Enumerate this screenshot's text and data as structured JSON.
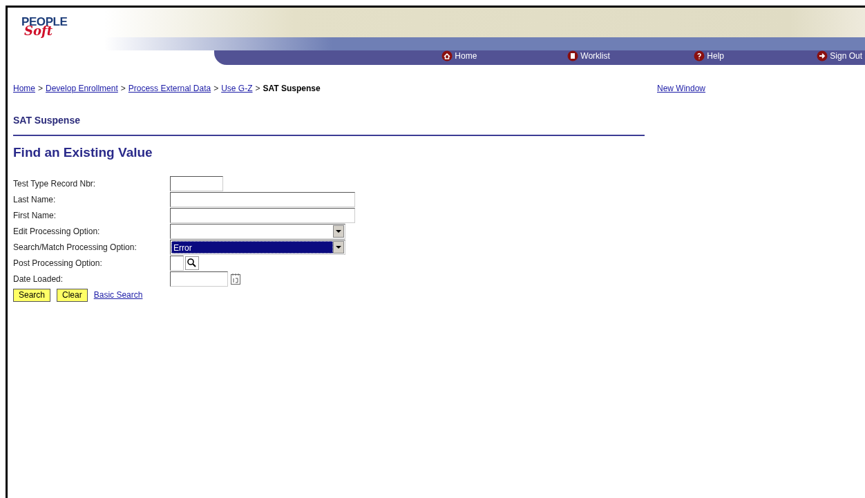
{
  "logo": {
    "line_1": "PEOPLE",
    "line_2": "Soft"
  },
  "nav": [
    {
      "label": "Home",
      "kind": "home"
    },
    {
      "label": "Worklist",
      "kind": "worklist"
    },
    {
      "label": "Help",
      "kind": "help"
    },
    {
      "label": "Sign Out",
      "kind": "signout"
    }
  ],
  "breadcrumb": {
    "links": [
      "Home",
      "Develop Enrollment",
      "Process External Data",
      "Use G-Z"
    ],
    "separator": ">",
    "current": "SAT Suspense"
  },
  "new_window": "New Window",
  "page_title": "SAT Suspense",
  "heading": "Find an Existing Value",
  "fields": [
    {
      "label": "Test Type Record Nbr:",
      "kind": "short_text"
    },
    {
      "label": "Last Name:",
      "kind": "text"
    },
    {
      "label": "First Name:",
      "kind": "text"
    },
    {
      "label": "Edit Processing Option:",
      "kind": "select",
      "selected": false
    },
    {
      "label": "Search/Match Processing Option:",
      "kind": "select",
      "value": "Error",
      "selected": true
    },
    {
      "label": "Post Processing Option:",
      "kind": "prompt"
    },
    {
      "label": "Date Loaded:",
      "kind": "date"
    }
  ],
  "buttons": [
    "Search",
    "Clear"
  ],
  "basic_search": "Basic Search"
}
